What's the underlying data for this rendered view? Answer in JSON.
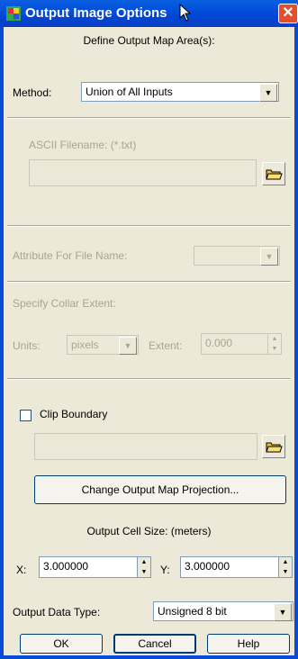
{
  "window": {
    "title": "Output Image Options",
    "close_glyph": "✕"
  },
  "subtitle": "Define Output Map Area(s):",
  "method": {
    "label": "Method:",
    "value": "Union of All Inputs"
  },
  "ascii": {
    "label": "ASCII Filename: (*.txt)",
    "value": ""
  },
  "attribute": {
    "label": "Attribute For File Name:",
    "value": ""
  },
  "collar": {
    "label": "Specify Collar Extent:",
    "units_label": "Units:",
    "units_value": "pixels",
    "extent_label": "Extent:",
    "extent_value": "0.000"
  },
  "clip": {
    "label": "Clip Boundary",
    "checked": false,
    "value": ""
  },
  "projection_button": "Change Output Map Projection...",
  "cell_size": {
    "label": "Output Cell Size: (meters)",
    "x_label": "X:",
    "x_value": "3.000000",
    "y_label": "Y:",
    "y_value": "3.000000"
  },
  "data_type": {
    "label": "Output Data Type:",
    "value": "Unsigned 8 bit"
  },
  "buttons": {
    "ok": "OK",
    "cancel": "Cancel",
    "help": "Help"
  },
  "colors": {
    "title_bar": "#0046D5",
    "dialog_bg": "#ECE9D8",
    "disabled_text": "#A7A690"
  }
}
